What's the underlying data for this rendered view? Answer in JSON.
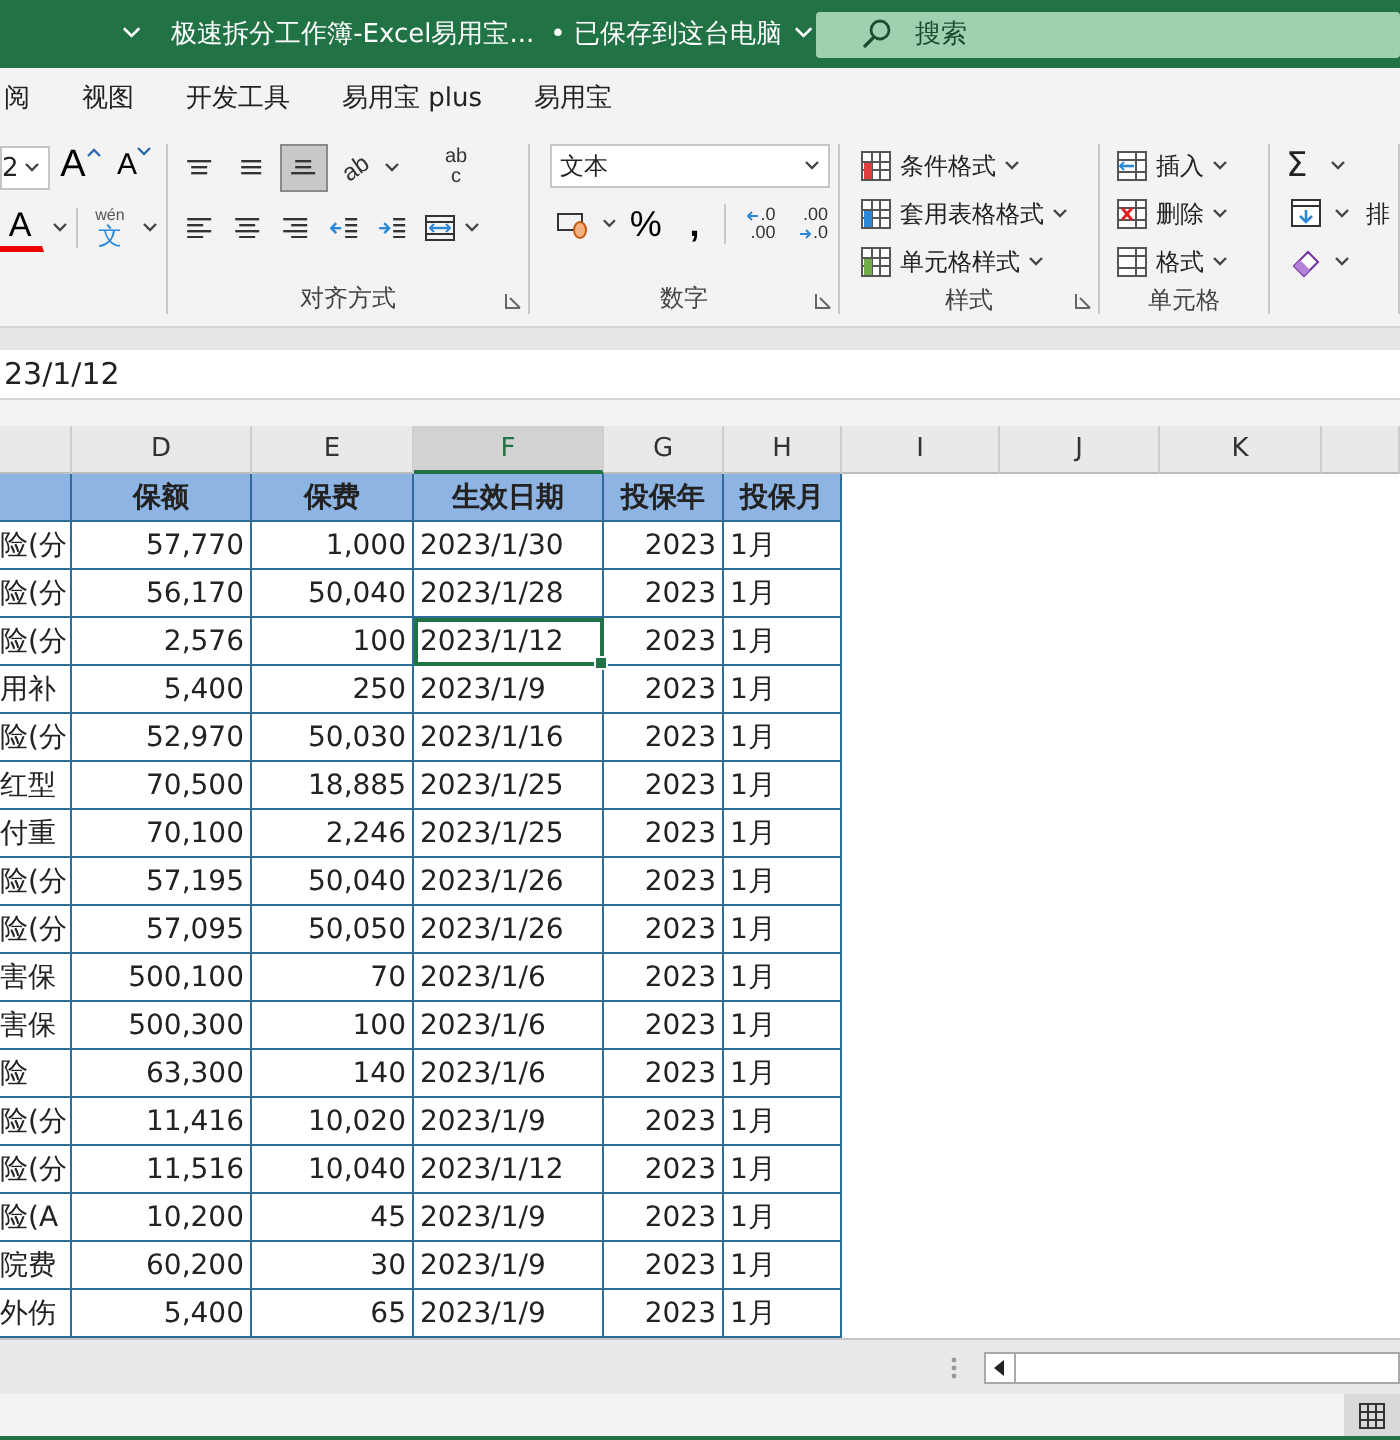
{
  "title_bar": {
    "title": "极速拆分工作簿-Excel易用宝...",
    "save_status": "• 已保存到这台电脑",
    "search": {
      "placeholder": "搜索"
    }
  },
  "ribbon_tabs": [
    {
      "label": "阅"
    },
    {
      "label": "视图"
    },
    {
      "label": "开发工具"
    },
    {
      "label": "易用宝 plus"
    },
    {
      "label": "易用宝"
    }
  ],
  "ribbon": {
    "font": {
      "size": "2",
      "tools": [
        {
          "kind": "grow",
          "glyph": "A"
        },
        {
          "kind": "shrink",
          "glyph": "A"
        },
        {
          "kind": "color",
          "glyph": "A"
        },
        {
          "kind": "phonetic",
          "glyph": "文",
          "ruby": "wén"
        }
      ]
    },
    "alignment": {
      "label": "对齐方式",
      "buttons": [
        {
          "kind": "top",
          "selected": false
        },
        {
          "kind": "middle",
          "selected": false
        },
        {
          "kind": "bottom",
          "selected": true
        },
        {
          "kind": "left",
          "selected": false
        },
        {
          "kind": "center",
          "selected": false
        },
        {
          "kind": "right",
          "selected": false
        },
        {
          "kind": "outdent",
          "selected": false
        },
        {
          "kind": "indent",
          "selected": false
        }
      ],
      "orientation": {
        "glyph": "ab"
      },
      "wrap": {
        "top": "ab",
        "bottom": "c"
      }
    },
    "number": {
      "label": "数字",
      "format": "文本",
      "percent": "%",
      "comma": ",",
      "decimals": [
        {
          "kind": "increase",
          "top": ".0",
          "bottom": ".00"
        },
        {
          "kind": "decrease",
          "top": ".00",
          "bottom": ".0"
        }
      ]
    },
    "styles": {
      "label": "样式",
      "items": [
        {
          "label": "条件格式"
        },
        {
          "label": "套用表格格式"
        },
        {
          "label": "单元格样式"
        }
      ]
    },
    "cells": {
      "label": "单元格",
      "items": [
        {
          "kind": "insert",
          "label": "插入"
        },
        {
          "kind": "delete",
          "label": "删除"
        },
        {
          "kind": "format",
          "label": "格式"
        }
      ]
    },
    "editing": {
      "sum": "Σ",
      "sort_label": "排"
    }
  },
  "formula_bar": {
    "value": "23/1/12"
  },
  "sheet": {
    "columns": [
      {
        "selected": false
      },
      {
        "label": "D",
        "selected": false
      },
      {
        "label": "E",
        "selected": false
      },
      {
        "label": "F",
        "selected": true
      },
      {
        "label": "G",
        "selected": false
      },
      {
        "label": "H",
        "selected": false
      },
      {
        "label": "I",
        "selected": false
      },
      {
        "label": "J",
        "selected": false
      },
      {
        "label": "K",
        "selected": false
      }
    ],
    "header": [
      {
        "text": "保额"
      },
      {
        "text": "保费"
      },
      {
        "text": "生效日期"
      },
      {
        "text": "投保年"
      },
      {
        "text": "投保月"
      }
    ],
    "rows": [
      {
        "cells": [
          "险(分",
          "57,770",
          "1,000",
          "2023/1/30",
          "2023",
          "1月"
        ],
        "selected": false
      },
      {
        "cells": [
          "险(分",
          "56,170",
          "50,040",
          "2023/1/28",
          "2023",
          "1月"
        ],
        "selected": false
      },
      {
        "cells": [
          "险(分",
          "2,576",
          "100",
          "2023/1/12",
          "2023",
          "1月"
        ],
        "selected": true
      },
      {
        "cells": [
          "用补",
          "5,400",
          "250",
          "2023/1/9",
          "2023",
          "1月"
        ],
        "selected": false
      },
      {
        "cells": [
          "险(分",
          "52,970",
          "50,030",
          "2023/1/16",
          "2023",
          "1月"
        ],
        "selected": false
      },
      {
        "cells": [
          "红型",
          "70,500",
          "18,885",
          "2023/1/25",
          "2023",
          "1月"
        ],
        "selected": false
      },
      {
        "cells": [
          "付重",
          "70,100",
          "2,246",
          "2023/1/25",
          "2023",
          "1月"
        ],
        "selected": false
      },
      {
        "cells": [
          "险(分",
          "57,195",
          "50,040",
          "2023/1/26",
          "2023",
          "1月"
        ],
        "selected": false
      },
      {
        "cells": [
          "险(分",
          "57,095",
          "50,050",
          "2023/1/26",
          "2023",
          "1月"
        ],
        "selected": false
      },
      {
        "cells": [
          "害保",
          "500,100",
          "70",
          "2023/1/6",
          "2023",
          "1月"
        ],
        "selected": false
      },
      {
        "cells": [
          "害保",
          "500,300",
          "100",
          "2023/1/6",
          "2023",
          "1月"
        ],
        "selected": false
      },
      {
        "cells": [
          "险",
          "63,300",
          "140",
          "2023/1/6",
          "2023",
          "1月"
        ],
        "selected": false
      },
      {
        "cells": [
          "险(分",
          "11,416",
          "10,020",
          "2023/1/9",
          "2023",
          "1月"
        ],
        "selected": false
      },
      {
        "cells": [
          "险(分",
          "11,516",
          "10,040",
          "2023/1/12",
          "2023",
          "1月"
        ],
        "selected": false
      },
      {
        "cells": [
          "险(A",
          "10,200",
          "45",
          "2023/1/9",
          "2023",
          "1月"
        ],
        "selected": false
      },
      {
        "cells": [
          "院费",
          "60,200",
          "30",
          "2023/1/9",
          "2023",
          "1月"
        ],
        "selected": false
      },
      {
        "cells": [
          "外伤",
          "5,400",
          "65",
          "2023/1/9",
          "2023",
          "1月"
        ],
        "selected": false
      }
    ]
  }
}
